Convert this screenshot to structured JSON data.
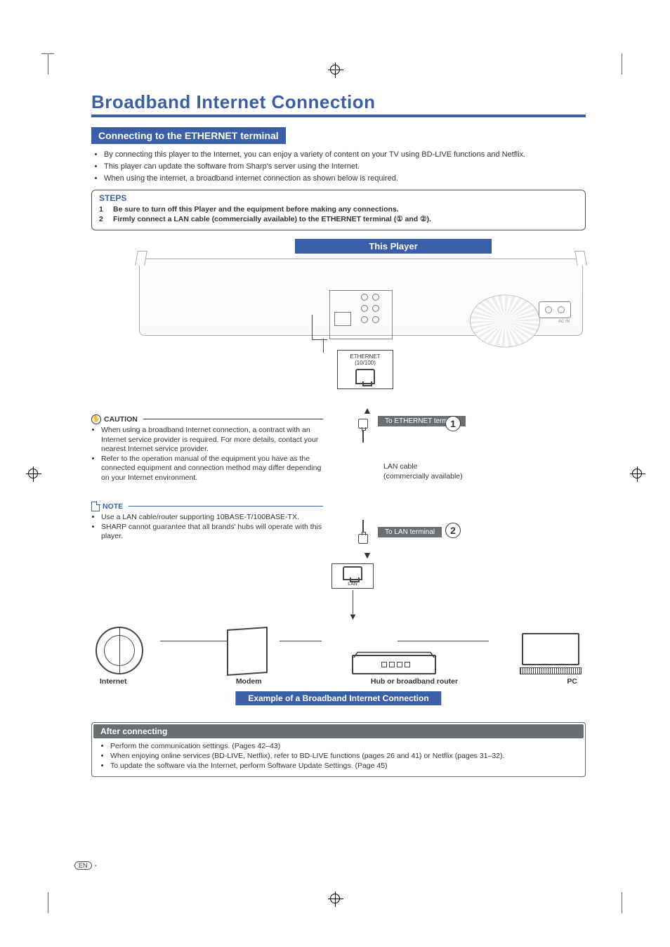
{
  "title": "Broadband Internet Connection",
  "section_heading": "Connecting to the ETHERNET terminal",
  "intro_bullets": [
    "By connecting this player to the Internet, you can enjoy a variety of content on your TV using BD-LIVE functions and Netflix.",
    "This player can update the software from Sharp's server using the Internet.",
    "When using the internet, a broadband internet connection as shown below is required."
  ],
  "steps": {
    "title": "STEPS",
    "items": [
      {
        "num": "1",
        "text": "Be sure to turn off this Player and the equipment before making any connections."
      },
      {
        "num": "2",
        "text": "Firmly connect a LAN cable (commercially available) to the ETHERNET terminal (① and ②)."
      }
    ]
  },
  "diagram": {
    "this_player": "This Player",
    "eth_callout_line1": "ETHERNET",
    "eth_callout_line2": "(10/100)",
    "ac_label": "AC IN",
    "to_ethernet": "To ETHERNET terminal",
    "lan_cable": "LAN cable",
    "lan_cable_sub": "(commercially available)",
    "to_lan": "To LAN terminal",
    "lan_port_label": "LAN",
    "internet": "Internet",
    "modem": "Modem",
    "router": "Hub or broadband router",
    "pc": "PC",
    "example": "Example of a Broadband Internet Connection"
  },
  "caution": {
    "title": "CAUTION",
    "items": [
      "When using a broadband Internet connection, a contract with an Internet service provider is required. For more details, contact your nearest Internet service provider.",
      "Refer to the operation manual of the equipment you have as the connected equipment and connection method may differ depending on your Internet environment."
    ]
  },
  "note": {
    "title": "NOTE",
    "items": [
      "Use a LAN cable/router supporting 10BASE-T/100BASE-TX.",
      "SHARP cannot guarantee that all brands' hubs will operate with this player."
    ]
  },
  "after": {
    "title": "After connecting",
    "items": [
      "Perform the communication settings. (Pages 42–43)",
      "When enjoying online services (BD-LIVE, Netflix), refer to BD-LIVE functions (pages 26 and 41) or Netflix (pages 31–32).",
      "To update the software via the Internet, perform Software Update Settings. (Page 45)"
    ]
  },
  "footer": {
    "lang": "EN",
    "dash": "-"
  }
}
